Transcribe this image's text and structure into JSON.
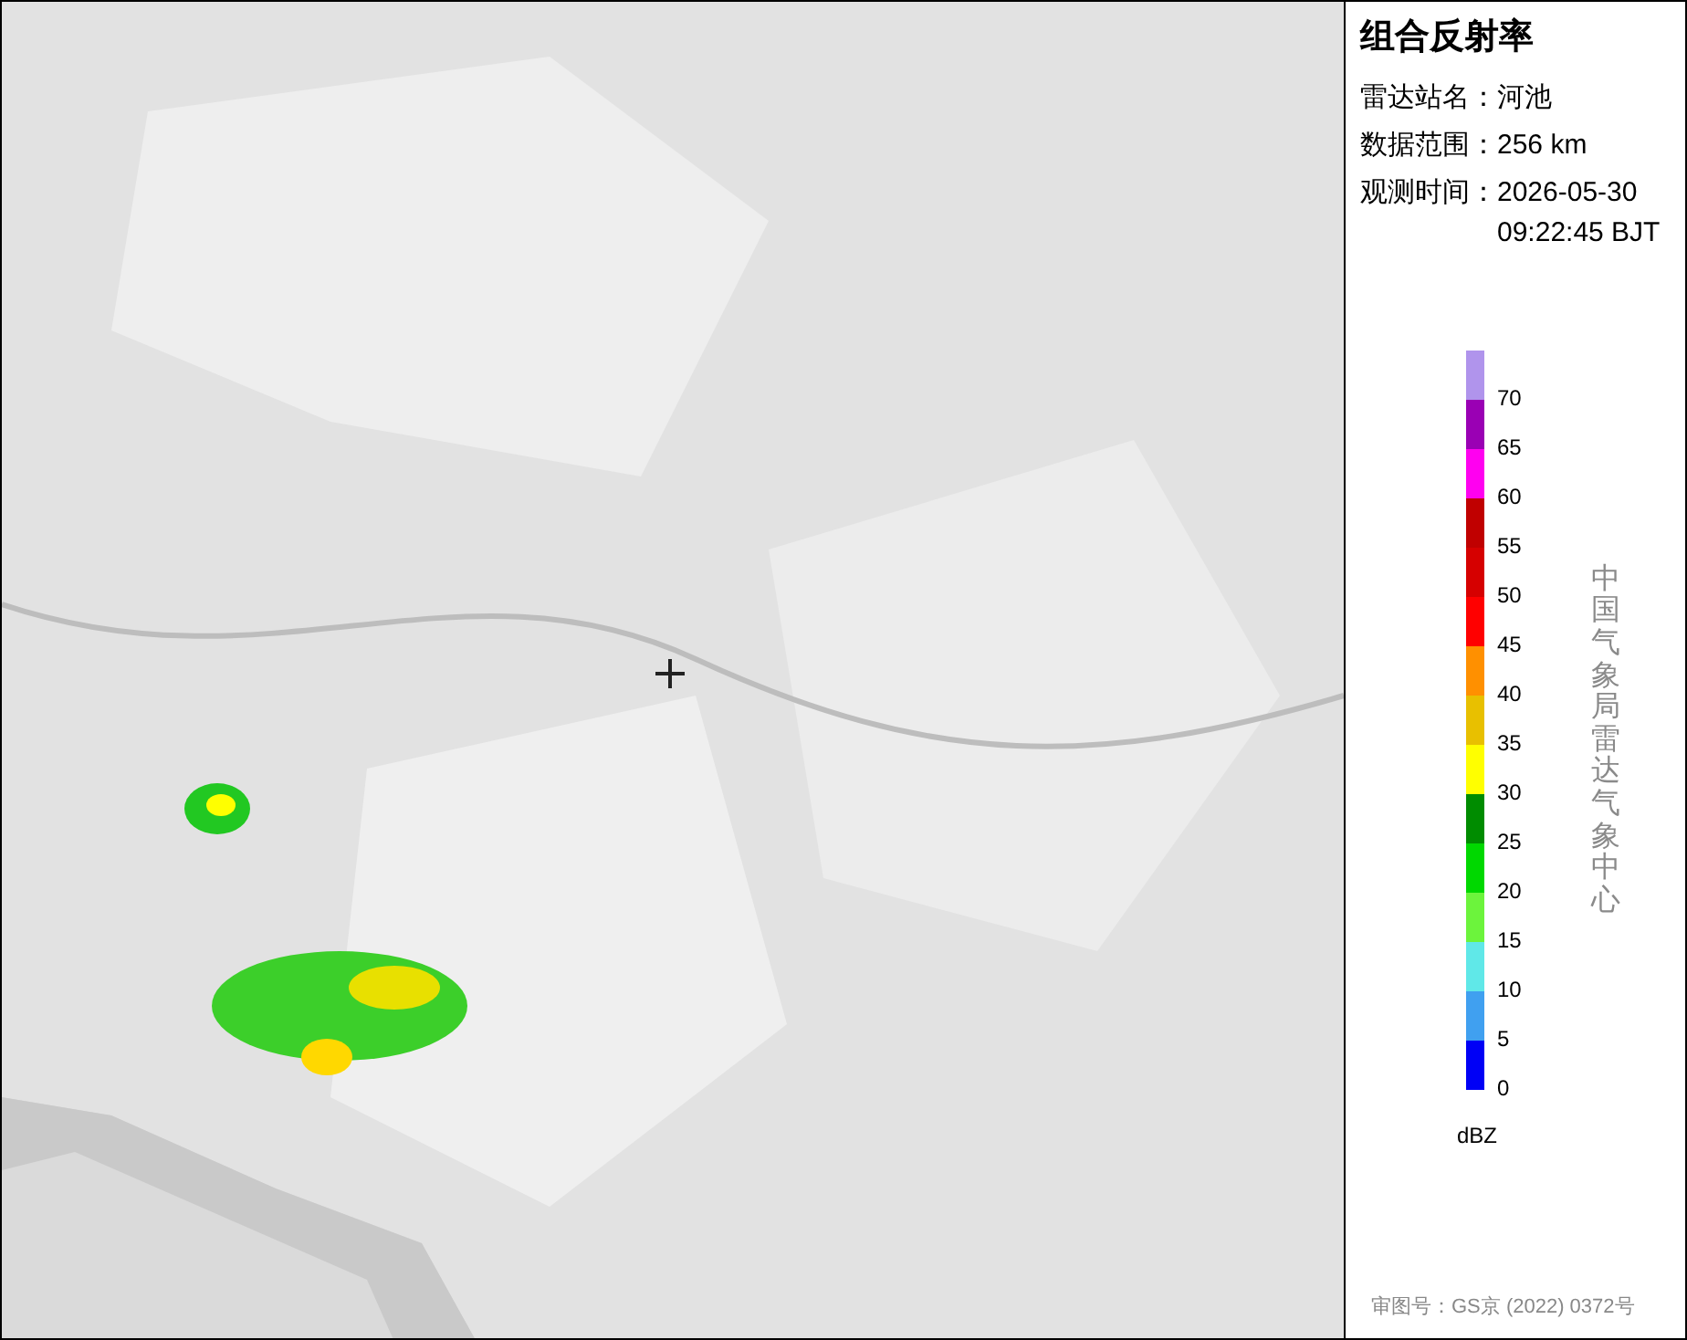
{
  "panel": {
    "title": "组合反射率",
    "info": [
      {
        "label": "雷达站名：",
        "value": "河池"
      },
      {
        "label": "数据范围：",
        "value": "256 km"
      },
      {
        "label": "观测时间：",
        "value": "2026-05-30\n09:22:45 BJT"
      }
    ],
    "legend": [
      {
        "color": "#b094ec",
        "label": "70"
      },
      {
        "color": "#9a00b4",
        "label": "65"
      },
      {
        "color": "#ff00f0",
        "label": "60"
      },
      {
        "color": "#c00000",
        "label": "55"
      },
      {
        "color": "#d60000",
        "label": "50"
      },
      {
        "color": "#ff0000",
        "label": "45"
      },
      {
        "color": "#ff9000",
        "label": "40"
      },
      {
        "color": "#e8c000",
        "label": "35"
      },
      {
        "color": "#ffff00",
        "label": "30"
      },
      {
        "color": "#008c00",
        "label": "25"
      },
      {
        "color": "#00d800",
        "label": "20"
      },
      {
        "color": "#6cf43c",
        "label": "15"
      },
      {
        "color": "#60e8e8",
        "label": "10"
      },
      {
        "color": "#40a0f0",
        "label": "5"
      },
      {
        "color": "#0000f6",
        "label": "0"
      }
    ],
    "unit": "dBZ",
    "credit": "中国气象局雷达气象中心",
    "approval_number": "审图号：GS京 (2022) 0372号"
  }
}
